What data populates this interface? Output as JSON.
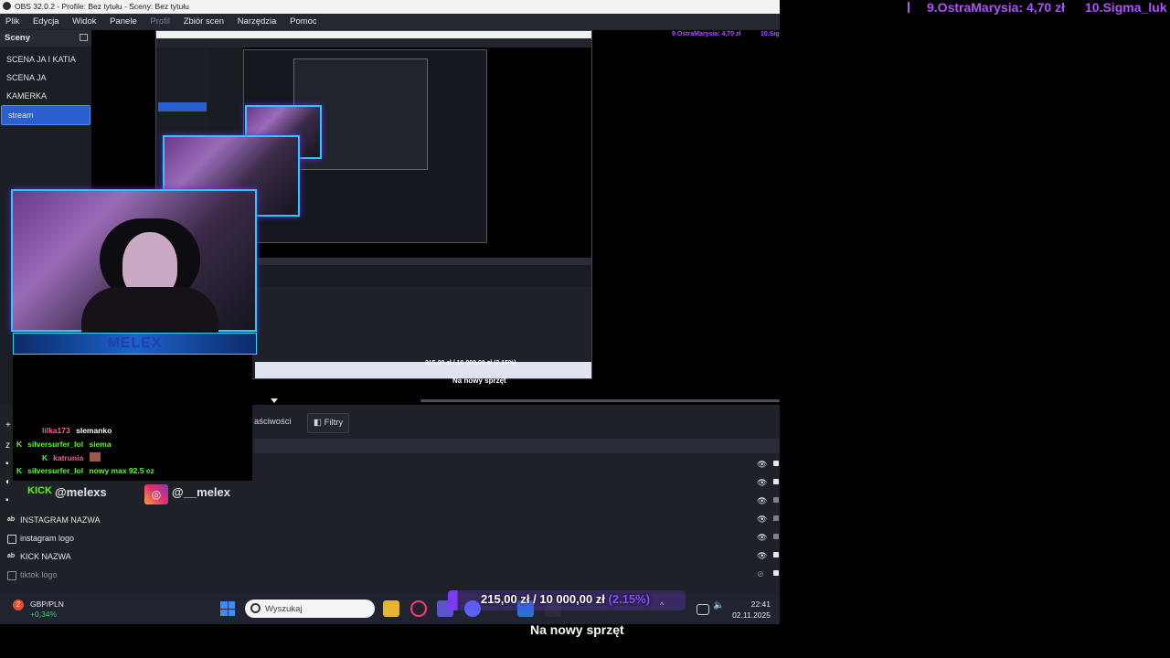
{
  "window": {
    "title": "OBS 32.0.2 - Profile: Bez tytułu - Sceny: Bez tytułu"
  },
  "menu": [
    "Plik",
    "Edycja",
    "Widok",
    "Panele",
    "Profil",
    "Zbiór scen",
    "Narzędzia",
    "Pomoc"
  ],
  "scenes": {
    "header": "Sceny",
    "items": [
      {
        "label": "SCENA JA I KATIA",
        "selected": false
      },
      {
        "label": "SCENA JA",
        "selected": false
      },
      {
        "label": "KAMERKA",
        "selected": false
      },
      {
        "label": "stream",
        "selected": true
      }
    ]
  },
  "overlay": {
    "name_banner": "MELEX",
    "kick_label": "KICK",
    "kick_handle": "@melexs",
    "ig_handle": "@__melex",
    "mini_caption": "Na nowy sprzęt",
    "mini_goal": "215,00 zł / 10 000,00 zł (2.15%)",
    "chat": [
      {
        "user": "lilka173",
        "user_color": "#ff5c9a",
        "message": "slemanko",
        "badge": false
      },
      {
        "user": "silversurfer_lol",
        "user_color": "#53fc18",
        "message": "siema",
        "badge": true
      },
      {
        "user": "katrunia",
        "user_color": "#ff5c9a",
        "message": "",
        "badge": false
      },
      {
        "user": "silversurfer_lol",
        "user_color": "#53fc18",
        "message": "nowy max 92.5 ez",
        "badge": true
      }
    ]
  },
  "tabs": {
    "properties": "aściwości",
    "filters": "Filtry"
  },
  "sources": [
    {
      "label": "",
      "visible": true,
      "locked": true
    },
    {
      "label": "",
      "visible": true,
      "locked": true
    },
    {
      "label": "",
      "visible": true,
      "locked": false
    },
    {
      "label": "INSTAGRAM NAZWA",
      "visible": true,
      "locked": false,
      "icon": "ab"
    },
    {
      "label": "instagram logo",
      "visible": true,
      "locked": false,
      "icon": "img"
    },
    {
      "label": "KICK NAZWA",
      "visible": true,
      "locked": true,
      "icon": "ab"
    },
    {
      "label": "tiktok logo",
      "visible": false,
      "locked": true,
      "icon": "img"
    }
  ],
  "taskbar": {
    "notification_count": "2",
    "currency_pair": "GBP/PLN",
    "currency_change": "+0,34%",
    "search_placeholder": "Wyszukaj",
    "time": "22:41",
    "date": "02.11.2025"
  },
  "goal": {
    "current": "215,00 zł",
    "target": "10 000,00 zł",
    "percent": "(2.15%)",
    "fraction": 0.0215
  },
  "caption": "Na nowy sprzęt",
  "ticker": [
    "9.OstraMarysia: 4,70 zł",
    "10.Sigma_luk"
  ],
  "mini_ticker": [
    "9.OstraMarysia: 4,70 zł",
    "10.Sig"
  ],
  "colors": {
    "accent": "#2a5fd0",
    "kick": "#53fc18",
    "ticker": "#b050ff"
  }
}
